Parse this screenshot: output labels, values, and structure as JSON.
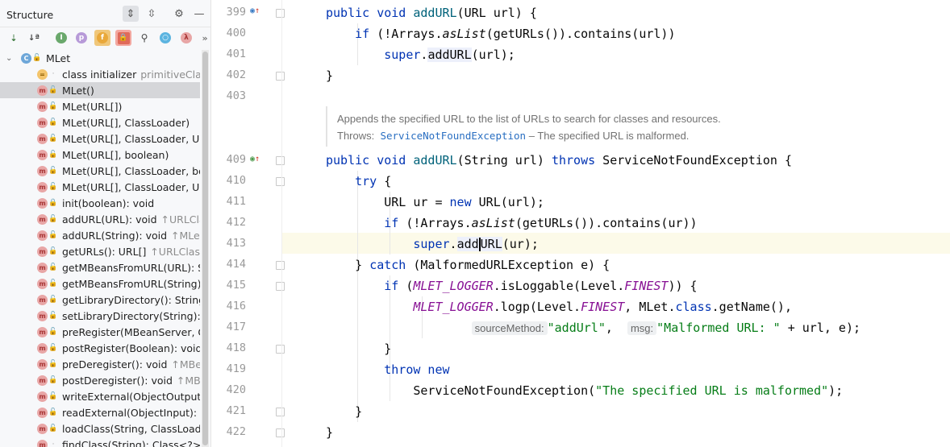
{
  "structure": {
    "title": "Structure",
    "class_name": "MLet",
    "items": [
      {
        "text": "class initializer",
        "hint": "primitiveClasses",
        "kind": "init",
        "vis": "pkg"
      },
      {
        "text": "MLet()",
        "hint": "",
        "kind": "method",
        "vis": "pub",
        "selected": true
      },
      {
        "text": "MLet(URL[])",
        "hint": "",
        "kind": "method",
        "vis": "pub"
      },
      {
        "text": "MLet(URL[], ClassLoader)",
        "hint": "",
        "kind": "method",
        "vis": "pub"
      },
      {
        "text": "MLet(URL[], ClassLoader, UR",
        "hint": "",
        "kind": "method",
        "vis": "pub"
      },
      {
        "text": "MLet(URL[], boolean)",
        "hint": "",
        "kind": "method",
        "vis": "pub"
      },
      {
        "text": "MLet(URL[], ClassLoader, boo",
        "hint": "",
        "kind": "method",
        "vis": "pub"
      },
      {
        "text": "MLet(URL[], ClassLoader, UR",
        "hint": "",
        "kind": "method",
        "vis": "pub"
      },
      {
        "text": "init(boolean): void",
        "hint": "",
        "kind": "method",
        "vis": "priv"
      },
      {
        "text": "addURL(URL): void",
        "hint": "↑URLCla",
        "kind": "method",
        "vis": "pub"
      },
      {
        "text": "addURL(String): void",
        "hint": "↑MLetM",
        "kind": "method",
        "vis": "pub"
      },
      {
        "text": "getURLs(): URL[]",
        "hint": "↑URLClass",
        "kind": "method",
        "vis": "pub"
      },
      {
        "text": "getMBeansFromURL(URL): S",
        "hint": "",
        "kind": "method",
        "vis": "pub"
      },
      {
        "text": "getMBeansFromURL(String):",
        "hint": "",
        "kind": "method",
        "vis": "pub"
      },
      {
        "text": "getLibraryDirectory(): String",
        "hint": "",
        "kind": "method",
        "vis": "pub"
      },
      {
        "text": "setLibraryDirectory(String): v",
        "hint": "",
        "kind": "method",
        "vis": "pub"
      },
      {
        "text": "preRegister(MBeanServer, Ob",
        "hint": "",
        "kind": "method",
        "vis": "pub"
      },
      {
        "text": "postRegister(Boolean): void",
        "hint": "↑",
        "kind": "method",
        "vis": "pub"
      },
      {
        "text": "preDeregister(): void",
        "hint": "↑MBea",
        "kind": "method",
        "vis": "pub"
      },
      {
        "text": "postDeregister(): void",
        "hint": "↑MBea",
        "kind": "method",
        "vis": "pub"
      },
      {
        "text": "writeExternal(ObjectOutput):",
        "hint": "",
        "kind": "method",
        "vis": "pub"
      },
      {
        "text": "readExternal(ObjectInput): vc",
        "hint": "",
        "kind": "method",
        "vis": "pub"
      },
      {
        "text": "loadClass(String, ClassLoade",
        "hint": "",
        "kind": "method",
        "vis": "pub"
      },
      {
        "text": "findClass(String): Class<?>",
        "hint": "↑",
        "kind": "method",
        "vis": "pkg"
      }
    ]
  },
  "editor": {
    "line_numbers": [
      "399",
      "400",
      "401",
      "402",
      "403",
      "409",
      "410",
      "411",
      "412",
      "413",
      "414",
      "415",
      "416",
      "417",
      "418",
      "419",
      "420",
      "421",
      "422"
    ],
    "doc": {
      "summary": "Appends the specified URL to the list of URLs to search for classes and resources.",
      "throws_label": "Throws:",
      "throws_link": "ServiceNotFoundException",
      "throws_desc": "– The specified URL is malformed."
    },
    "hints": {
      "source_method": "sourceMethod:",
      "msg": "msg:"
    },
    "strings": {
      "add_url": "\"addUrl\"",
      "malformed": "\"Malformed URL: \"",
      "specified": "\"The specified URL is malformed\""
    }
  },
  "colors": {
    "keyword": "#0033b3",
    "string": "#067d17",
    "constant": "#871094",
    "current_line": "#fcfae9"
  }
}
